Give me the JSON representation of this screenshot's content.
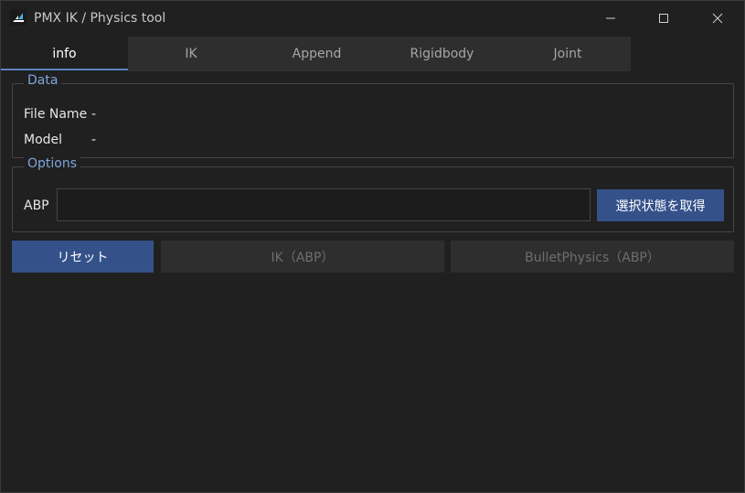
{
  "window": {
    "title": "PMX IK / Physics tool"
  },
  "tabs": [
    {
      "label": "info",
      "active": true
    },
    {
      "label": "IK",
      "active": false
    },
    {
      "label": "Append",
      "active": false
    },
    {
      "label": "Rigidbody",
      "active": false
    },
    {
      "label": "Joint",
      "active": false
    }
  ],
  "data_group": {
    "legend": "Data",
    "file_name_label": "File Name",
    "file_name_value": "-",
    "model_label": "Model",
    "model_value": "-"
  },
  "options_group": {
    "legend": "Options",
    "abp_label": "ABP",
    "abp_value": "",
    "fetch_button": "選択状態を取得"
  },
  "actions": {
    "reset": "リセット",
    "ik_abp": "IK（ABP）",
    "bullet_abp": "BulletPhysics（ABP）"
  },
  "colors": {
    "accent": "#34518a",
    "legend": "#7fa6db",
    "background": "#202020"
  }
}
